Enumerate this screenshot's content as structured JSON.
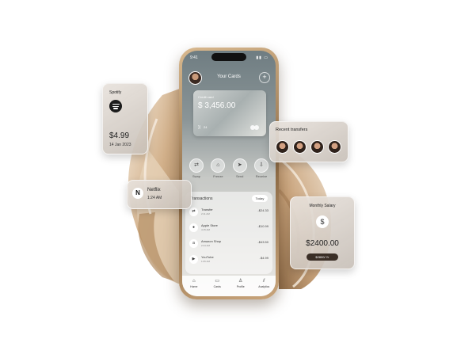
{
  "phone": {
    "status_time": "9:41",
    "header_title": "Your Cards",
    "card": {
      "label": "Credit card",
      "balance": "$ 3,456.00",
      "nfc_glyph": "))",
      "number": "24"
    },
    "actions": [
      {
        "label": "Swap",
        "icon": "swap-icon",
        "glyph": "⇄"
      },
      {
        "label": "Freeze",
        "icon": "lock-icon",
        "glyph": "⌂"
      },
      {
        "label": "Send",
        "icon": "send-icon",
        "glyph": "➤"
      },
      {
        "label": "Receive",
        "icon": "receive-icon",
        "glyph": "⇩"
      }
    ],
    "transactions": {
      "title": "Transactions",
      "filter": "Today",
      "items": [
        {
          "name": "Transfer",
          "time": "2:11 AM",
          "amount": "-$24.33",
          "glyph": "⇄"
        },
        {
          "name": "Apple Store",
          "time": "4:15 AM",
          "amount": "-$10.99",
          "glyph": "●"
        },
        {
          "name": "Amazon Shop",
          "time": "2:24 AM",
          "amount": "-$43.50",
          "glyph": "a"
        },
        {
          "name": "YouTube",
          "time": "1:05 AM",
          "amount": "-$4.99",
          "glyph": "▶"
        }
      ]
    },
    "nav": [
      {
        "label": "Home",
        "icon": "home-icon",
        "glyph": "⌂"
      },
      {
        "label": "Cards",
        "icon": "card-icon",
        "glyph": "▭"
      },
      {
        "label": "Profile",
        "icon": "user-icon",
        "glyph": "♙"
      },
      {
        "label": "Analytics",
        "icon": "chart-icon",
        "glyph": "⫽"
      }
    ]
  },
  "spotify": {
    "name": "Spotify",
    "price": "$4.99",
    "date": "14 Jan 2023"
  },
  "netflix": {
    "logo": "N",
    "name": "Netflix",
    "time": "1:24 AM"
  },
  "recent_transfers": {
    "title": "Recent transfers",
    "count": 4
  },
  "salary": {
    "title": "Monthly Salary",
    "amount": "$2400.00",
    "badge": "$2800/ Yr",
    "glyph": "$"
  },
  "colors": {
    "accent_dark": "#3a2e26",
    "swirl_light": "#f0e3d2",
    "swirl_dark": "#b08a62"
  }
}
